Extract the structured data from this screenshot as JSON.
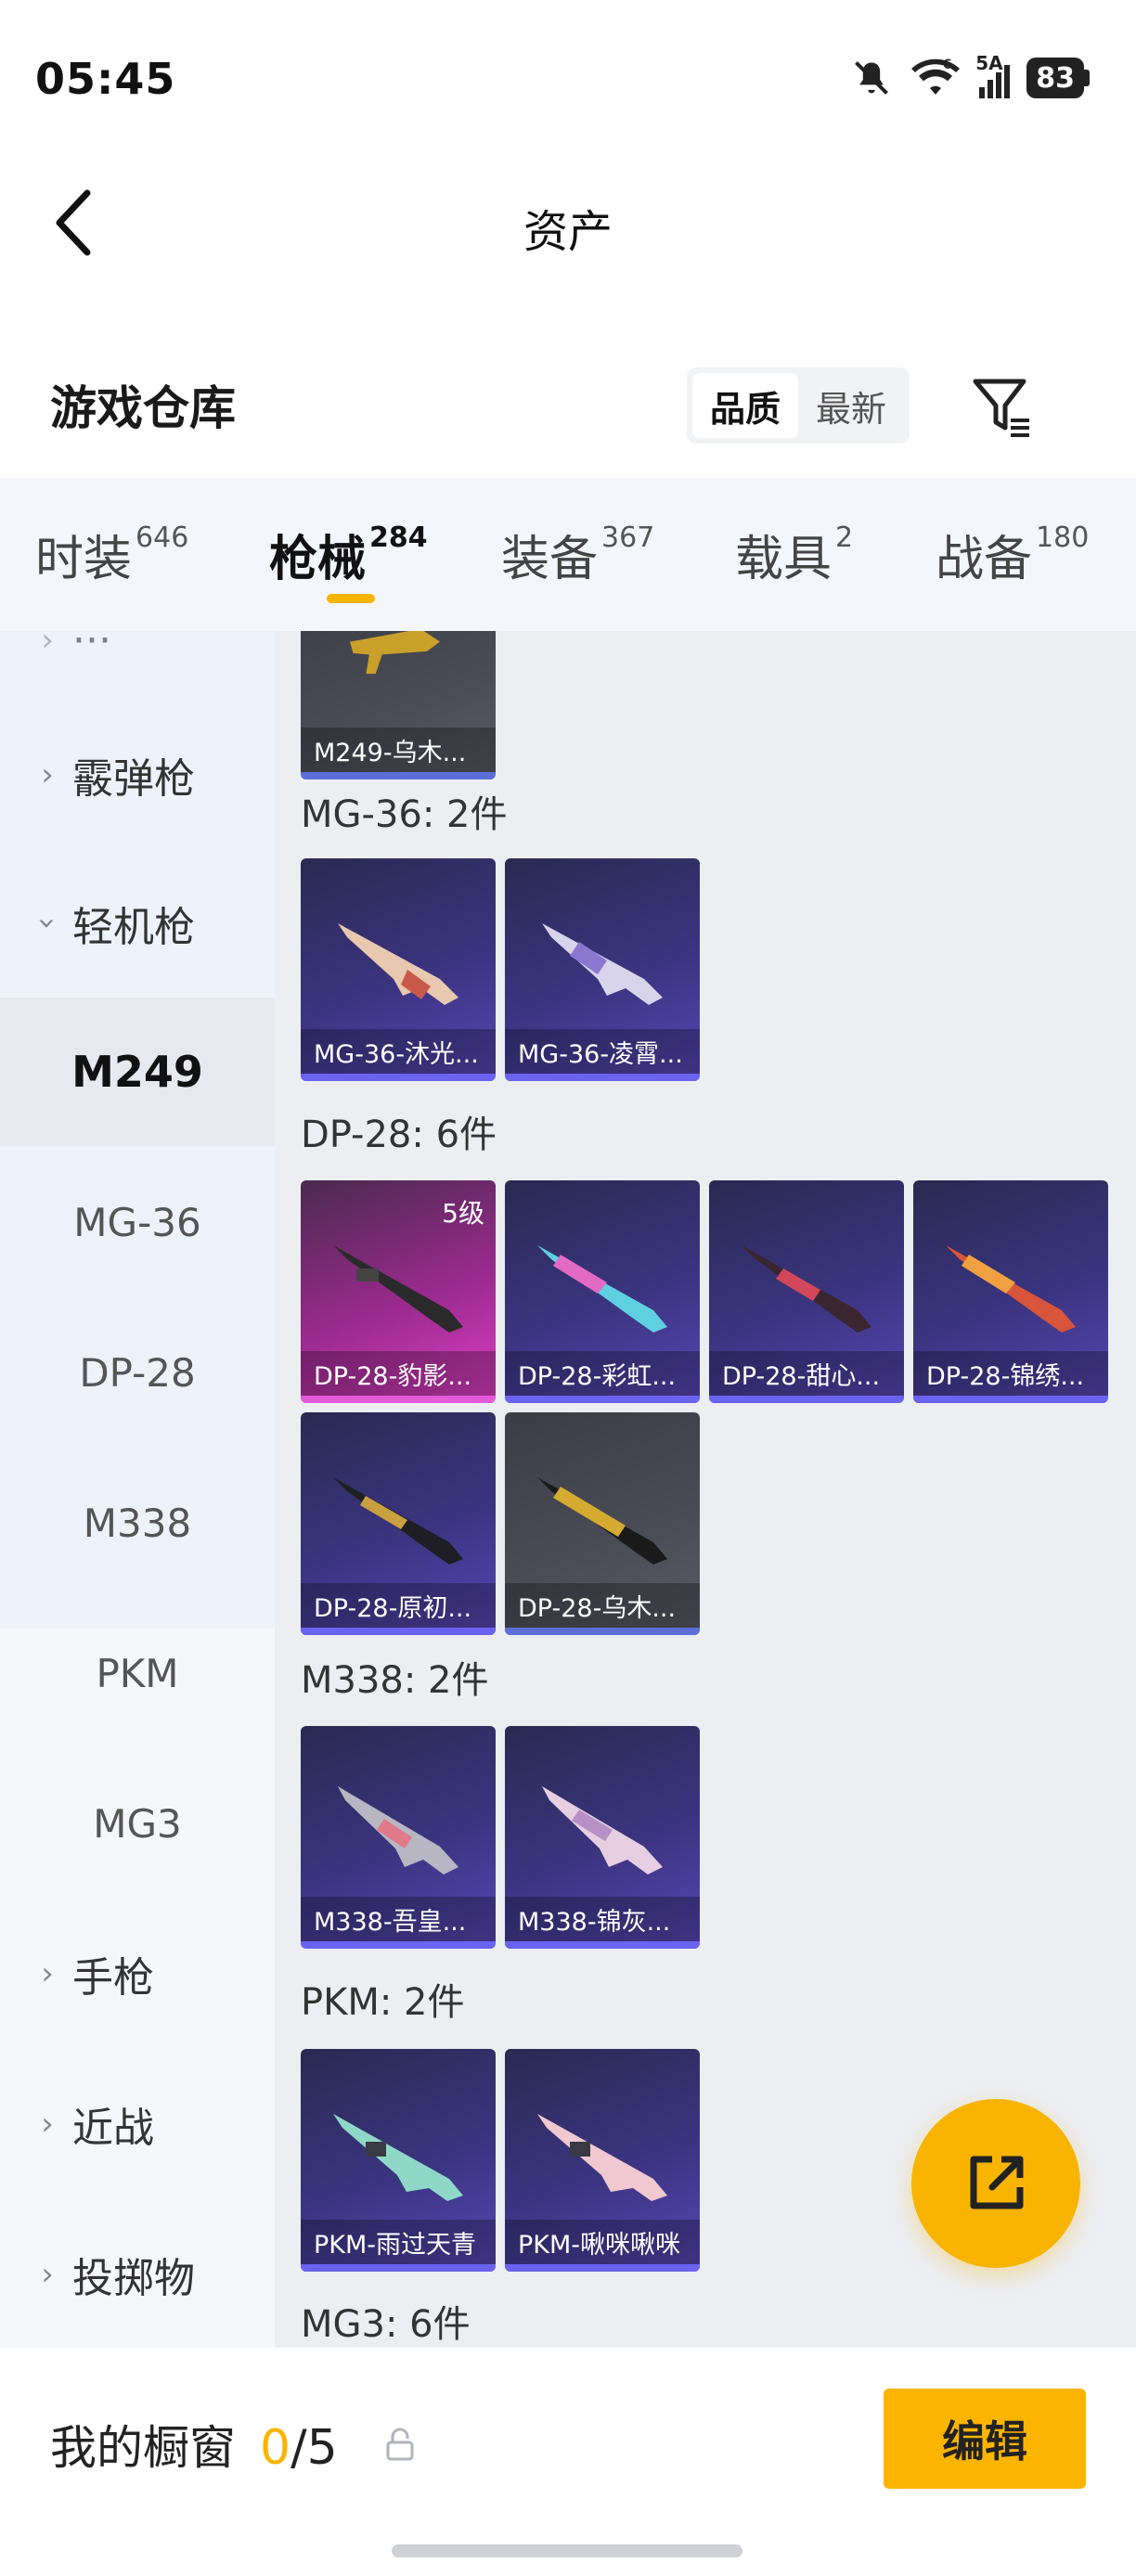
{
  "status": {
    "time": "05:45",
    "battery": "83",
    "network": "5A"
  },
  "header": {
    "title": "资产"
  },
  "warehouse": {
    "title": "游戏仓库",
    "sort_options": [
      "品质",
      "最新"
    ],
    "sort_selected": "品质"
  },
  "tabs": [
    {
      "label": "时装",
      "count": "646"
    },
    {
      "label": "枪械",
      "count": "284",
      "active": true
    },
    {
      "label": "装备",
      "count": "367"
    },
    {
      "label": "载具",
      "count": "2"
    },
    {
      "label": "战备",
      "count": "180"
    }
  ],
  "sidebar": {
    "groups": [
      {
        "label": "霰弹枪"
      },
      {
        "label": "轻机枪",
        "expanded": true
      },
      {
        "label": "手枪"
      },
      {
        "label": "近战"
      },
      {
        "label": "投掷物"
      }
    ],
    "subs": [
      "M249",
      "MG-36",
      "DP-28",
      "M338",
      "PKM",
      "MG3"
    ],
    "active_sub": "M249"
  },
  "content": {
    "top_card": {
      "name": "M249-乌木..."
    },
    "sections": [
      {
        "label": "MG-36: 2件",
        "items": [
          "MG-36-沐光...",
          "MG-36-凌霄..."
        ]
      },
      {
        "label": "DP-28: 6件",
        "items": [
          "DP-28-豹影...",
          "DP-28-彩虹...",
          "DP-28-甜心...",
          "DP-28-锦绣...",
          "DP-28-原初...",
          "DP-28-乌木..."
        ]
      },
      {
        "label": "M338: 2件",
        "items": [
          "M338-吾皇...",
          "M338-锦灰..."
        ]
      },
      {
        "label": "PKM: 2件",
        "items": [
          "PKM-雨过天青",
          "PKM-啾咪啾咪"
        ]
      },
      {
        "label": "MG3: 6件",
        "items": []
      }
    ],
    "level_badge": "5级"
  },
  "bottom": {
    "showcase_label": "我的橱窗",
    "showcase_used": "0",
    "showcase_total": "/5",
    "edit_label": "编辑"
  },
  "colors": {
    "accent": "#f8b400",
    "purple_card": "#3b3480",
    "pink_card": "#e040c6"
  }
}
